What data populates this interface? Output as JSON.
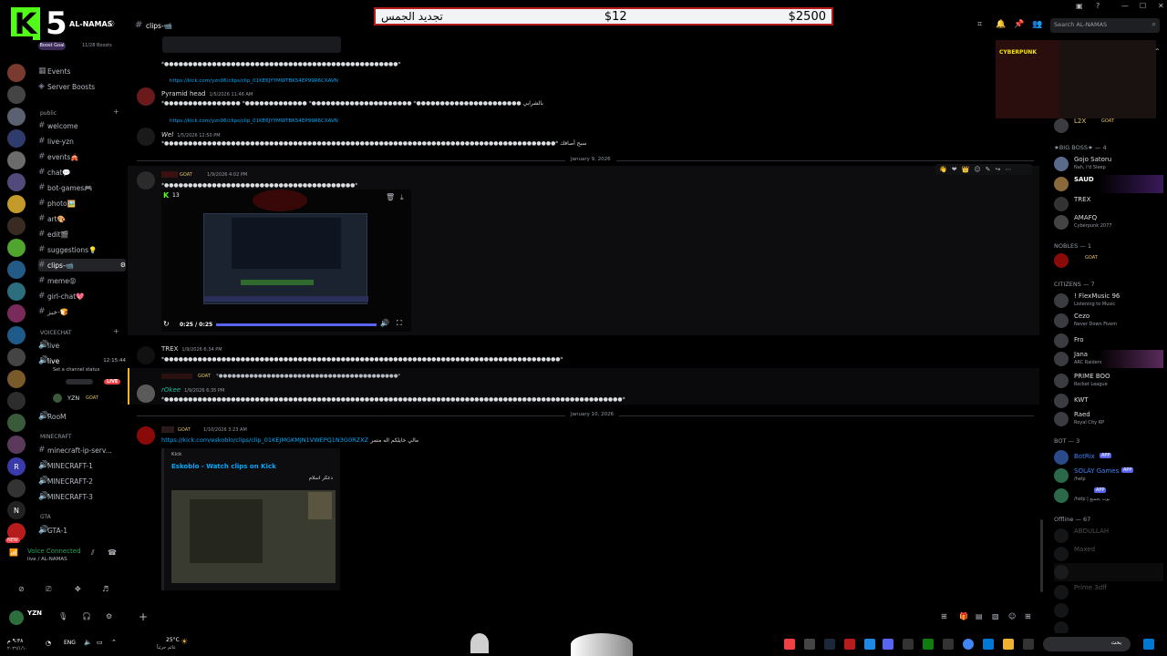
{
  "overlay": {
    "logo_letter": "K",
    "logo_number": "5",
    "banner_left_label": "تجديد الجمس",
    "banner_mid_price": "$12",
    "banner_right_price": "$2500"
  },
  "server": {
    "name": "AL-NAMAS",
    "boost_goal_label": "Boost Goal",
    "boost_count": "11/28 Boosts"
  },
  "sidebar": {
    "top_items": [
      {
        "label": "Events"
      },
      {
        "label": "Server Boosts"
      }
    ],
    "public_label": "public",
    "channels": [
      {
        "label": "welcome"
      },
      {
        "label": "live-yzn"
      },
      {
        "label": "events🎪"
      },
      {
        "label": "chat💬"
      },
      {
        "label": "bot-games🎮"
      },
      {
        "label": "photo🖼️"
      },
      {
        "label": "art🎨"
      },
      {
        "label": "edit🎬"
      },
      {
        "label": "suggestions💡"
      },
      {
        "label": "clips-📹"
      },
      {
        "label": "meme😝"
      },
      {
        "label": "girl-chat💖"
      },
      {
        "label": "خبز-🍞"
      }
    ],
    "voicechat_label": "VOICECHAT",
    "voice_channels": [
      {
        "label": "live"
      },
      {
        "label": "live"
      }
    ],
    "live_timer": "12:15:44",
    "channel_status": "Set a channel status",
    "voice_users": [
      {
        "name": "YZN",
        "tag": "GOAT"
      }
    ],
    "live_badge": "LIVE",
    "room_label": "RooM",
    "minecraft_label": "MINECRAFT",
    "minecraft_channels": [
      {
        "label": "minecraft-ip-serv..."
      },
      {
        "label": "MINECRAFT-1"
      },
      {
        "label": "MINECRAFT-2"
      },
      {
        "label": "MINECRAFT-3"
      }
    ],
    "gta_label": "GTA",
    "gta_channels": [
      {
        "label": "GTA-1"
      }
    ],
    "voice_connected": "Voice Connected",
    "voice_location": "live / AL-NAMAS",
    "user_name": "YZN",
    "new_badge": "NEW"
  },
  "topbar": {
    "channel_name": "clips-📹",
    "search_placeholder": "Search AL-NAMAS"
  },
  "messages": {
    "m1_text": "*●●●●●●●●●●●●●●●●●●●●●●●●●●●●●●●●●●●●●●●●●●●●●●●●●*",
    "m2_reply_link": "https://kick.com/yzn06/clips/clip_01KE6JYYMWTBK54EP99R6CXAVN",
    "m2_author": "Pyramid head",
    "m2_time": "1/5/2026 11:46 AM",
    "m2_text": "*●●●●●●●●●●●●●●●● *●●●●●●●●●●●●● *●●●●●●●●●●●●●●●●●●●●● *●●●●●●●●●●●●●●●●●●●●●● بالشرابي",
    "m3_reply_link": "https://kick.com/yzn06/clips/clip_01KE6JYYMWTBK54EP99R6CXAVN",
    "m3_author": "Wel",
    "m3_time": "1/5/2026 12:50 PM",
    "m3_text": "*●●●●●●●●●●●●●●●●●●●●●●●●●●●●●●●●●●●●●●●●●●●●●●●●●●●●●●●●●●●●●●●●●●●●●●●●●●●●●●●●●●* سبح أصافك",
    "date1": "January 9, 2026",
    "m4_tag": "GOAT",
    "m4_time": "1/9/2026 4:02 PM",
    "m4_text": "*●●●●●●●●●●●●●●●●●●●●●●●●●●●●●●●●●●●●●●●●*",
    "m4_video_viewers": "13",
    "m4_video_time": "0:25 / 0:25",
    "m5_author": "TREX",
    "m5_time": "1/9/2026 6:34 PM",
    "m5_text": "*●●●●●●●●●●●●●●●●●●●●●●●●●●●●●●●●●●●●●●●●●●●●●●●●●●●●●●●●●●●●●●●●●●●●●●●●●●●●●●●●●●●*",
    "m6_reply_tag": "GOAT",
    "m6_reply_text": "*●●●●●●●●●●●●●●●●●●●●●●●●●●●●●●●●●●●●●●●●●*",
    "m6_author": "rOkee",
    "m6_time": "1/9/2026 6:35 PM",
    "m6_text": "*●●●●●●●●●●●●●●●●●●●●●●●●●●●●●●●●●●●●●●●●●●●●●●●●●●●●●●●●●●●●●●●●●●●●●●●●●●●●●●●●●●●●●●●●●●●●●●●●*",
    "date2": "January 10, 2026",
    "m7_tag": "GOAT",
    "m7_time": "1/10/2026 3:23 AM",
    "m7_link": "https://kick.com/eskoblo/clips/clip_01KEJMGKMJN1VWEPQ1N3G0RZXZ",
    "m7_link_suffix": "مالي خايلكم اله متمر",
    "embed_provider": "Kick",
    "embed_title": "Eskoblo - Watch clips on Kick",
    "embed_desc": "دعكر اسلام"
  },
  "members": {
    "first": {
      "name": "L2X",
      "tag": "GOAT"
    },
    "big_boss_label": "★BIG BOSS★ — 4",
    "big_boss": [
      {
        "name": "Gojo Satoru",
        "status": "Nah, I'd Sleep"
      },
      {
        "name": "SAUD",
        "status": ""
      },
      {
        "name": "TREX",
        "status": ""
      },
      {
        "name": "AMAFQ",
        "status": "Cyberpunk 2077"
      }
    ],
    "nobles_label": "NOBLES — 1",
    "nobles": [
      {
        "name": "GOAT",
        "status": ""
      }
    ],
    "citizens_label": "CITIZENS — 7",
    "citizens": [
      {
        "name": "! FlexMusic 96",
        "status": "Listening to Music"
      },
      {
        "name": "Cezo",
        "status": "Never Down Fivem"
      },
      {
        "name": "Fro",
        "status": ""
      },
      {
        "name": "Jana",
        "status": "ARC Raiders"
      },
      {
        "name": "PRIME BOO",
        "status": "Rocket League"
      },
      {
        "name": "KWT",
        "status": ""
      },
      {
        "name": "Raed",
        "status": "Royal City RP"
      }
    ],
    "bot_label": "BOT — 3",
    "bots": [
      {
        "name": "BotRix",
        "tag": "APP",
        "status": ""
      },
      {
        "name": "SOLAY Games",
        "tag": "APP",
        "status": "/help"
      },
      {
        "name": "",
        "tag": "APP",
        "status": "/help | بوت بجميع"
      }
    ],
    "offline_label": "Offline — 67",
    "offline": [
      {
        "name": "ABDULLAH"
      },
      {
        "name": "Maxed"
      },
      {
        "name": ""
      },
      {
        "name": "Prime 3dff"
      },
      {
        "name": ""
      },
      {
        "name": ""
      }
    ],
    "game_banner": "CYBERPUNK"
  },
  "taskbar": {
    "weather_temp": "25°C",
    "weather_desc": "غائم جزئياً",
    "lang": "ENG",
    "search_label": "بحث",
    "time": "٩:٣٨ م",
    "date": "٢٠٢٦/١/١٠"
  }
}
